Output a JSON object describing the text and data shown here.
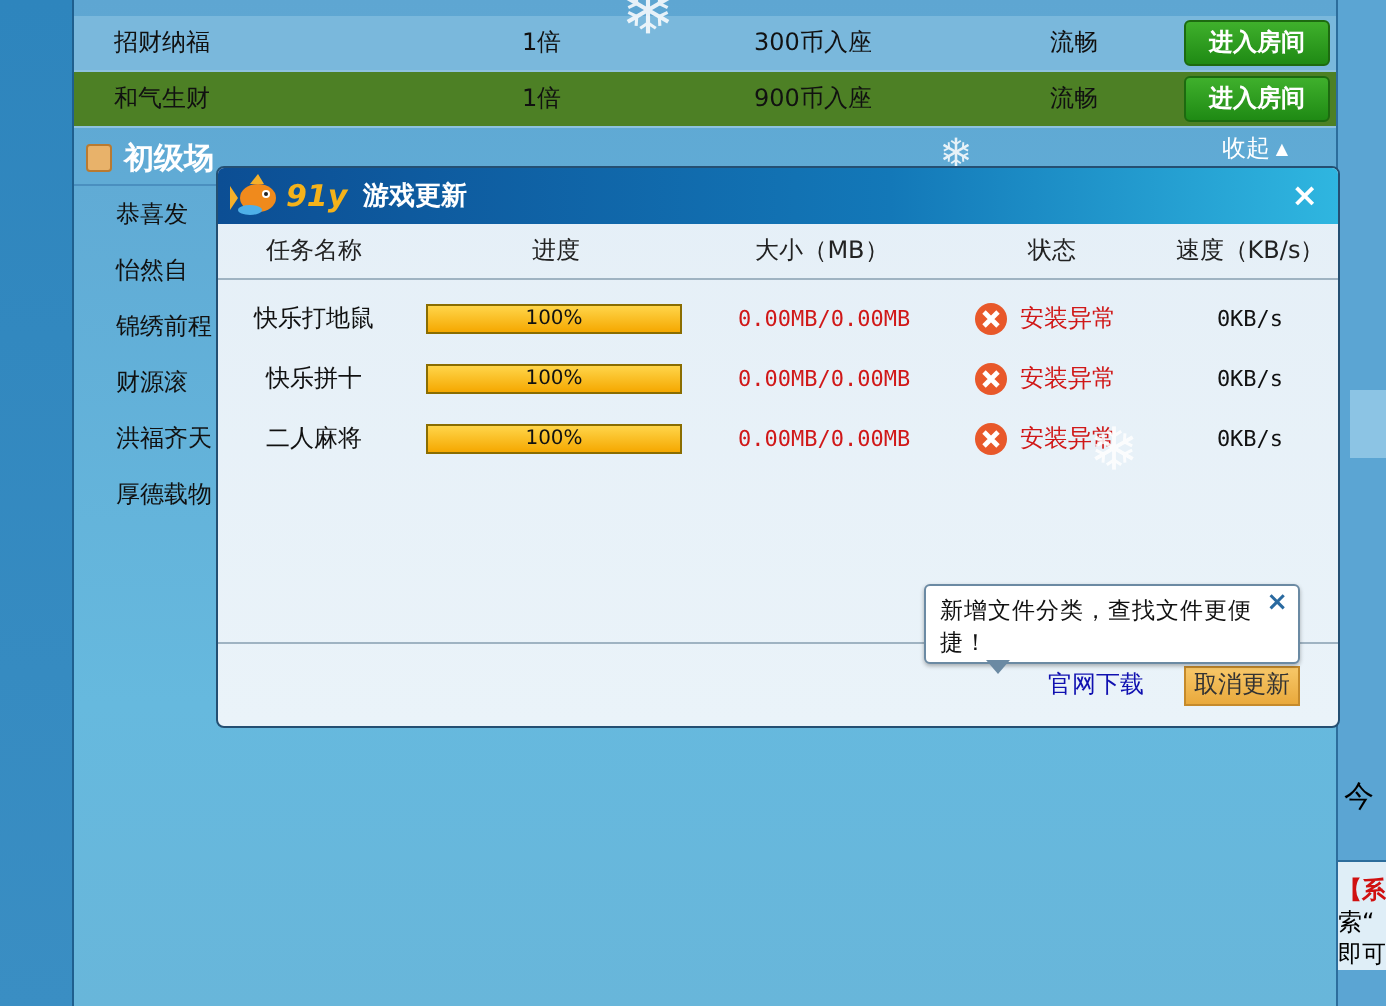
{
  "rooms": [
    {
      "name": "招财纳福",
      "multiplier": "1倍",
      "entry": "300币入座",
      "status": "流畅",
      "button": "进入房间",
      "selected": false
    },
    {
      "name": "和气生财",
      "multiplier": "1倍",
      "entry": "900币入座",
      "status": "流畅",
      "button": "进入房间",
      "selected": true
    }
  ],
  "section": {
    "title": "初级场",
    "toggle": "收起",
    "toggle_arrow": "▲"
  },
  "section_items": [
    "恭喜发",
    "怡然自",
    "锦绣前程",
    "财源滚",
    "洪福齐天",
    "厚德载物"
  ],
  "side_panel": {
    "heading": "今",
    "notice_tag": "【系",
    "notice_lines": [
      "索“",
      "即可"
    ]
  },
  "dialog": {
    "logo": "91y",
    "title": "游戏更新",
    "close": "×",
    "columns": [
      "任务名称",
      "进度",
      "大小（MB）",
      "状态",
      "速度（KB/s）"
    ],
    "tasks": [
      {
        "name": "快乐打地鼠",
        "level": 1,
        "progress": "100%",
        "size": "0.00MB/0.00MB",
        "status": "安装异常",
        "kind": "error",
        "speed": "0KB/s"
      },
      {
        "name": "快乐拼十",
        "level": 1,
        "progress": "100%",
        "size": "0.00MB/0.00MB",
        "status": "安装异常",
        "kind": "error",
        "speed": "0KB/s"
      },
      {
        "name": "二人麻将",
        "level": 1,
        "progress": "100%",
        "size": "0.00MB/0.00MB",
        "status": "安装异常",
        "kind": "error",
        "speed": "0KB/s"
      }
    ],
    "link": "官网下载",
    "cancel_button": "取消更新",
    "tooltip": {
      "text": "新增文件分类，查找文件更便捷！",
      "close": "×"
    }
  }
}
